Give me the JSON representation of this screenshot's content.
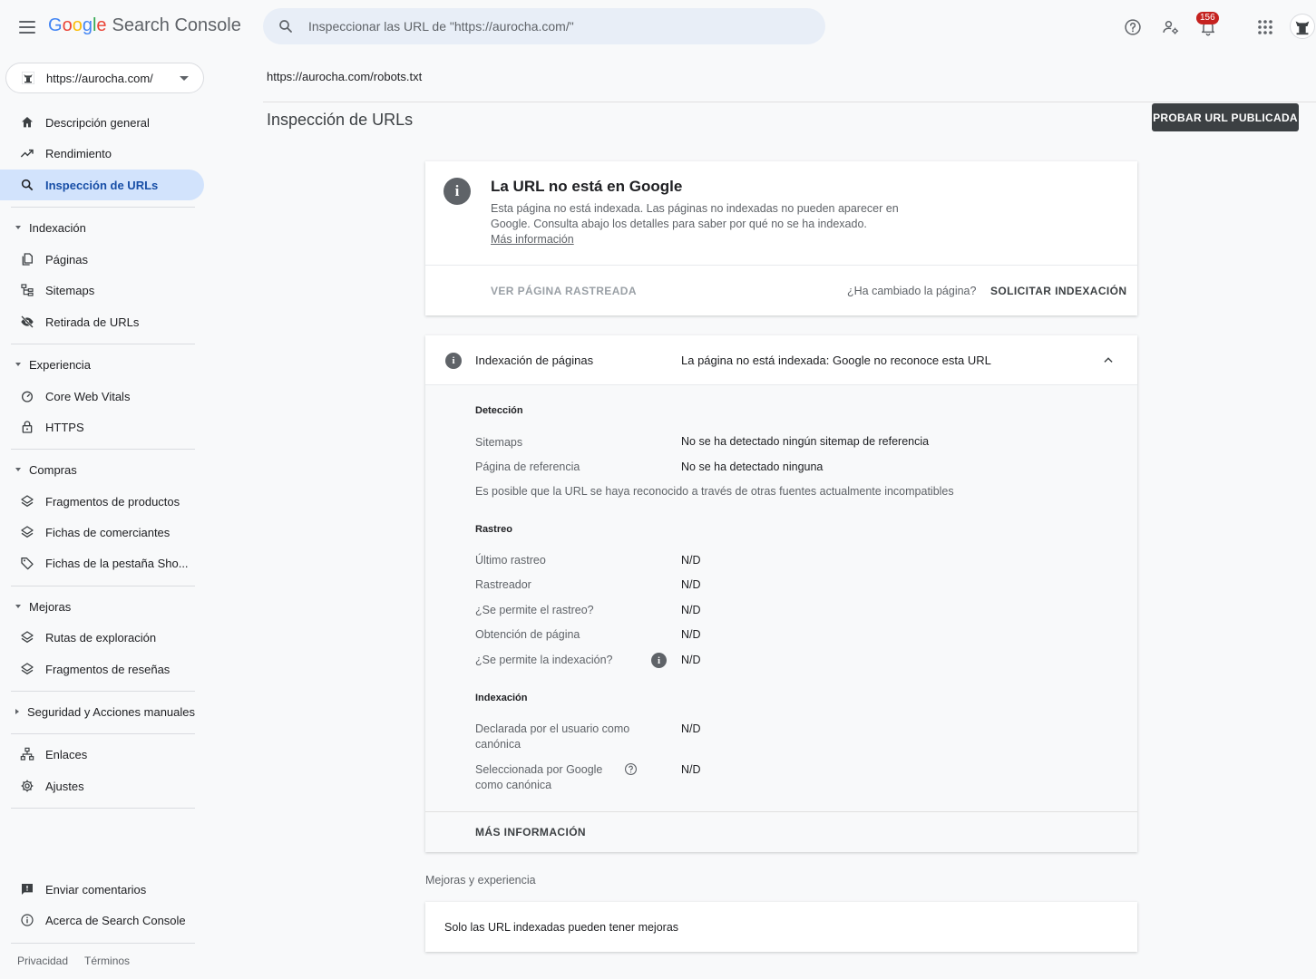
{
  "header": {
    "logo_letters": [
      "G",
      "o",
      "o",
      "g",
      "l",
      "e"
    ],
    "product_name": "Search Console",
    "search_placeholder": "Inspeccionar las URL de \"https://aurocha.com/\"",
    "notification_count": "156"
  },
  "sidebar": {
    "property": "https://aurocha.com/",
    "items_top": [
      {
        "label": "Descripción general",
        "icon": "home-icon"
      },
      {
        "label": "Rendimiento",
        "icon": "trending-up-icon"
      },
      {
        "label": "Inspección de URLs",
        "icon": "search-icon",
        "active": true
      }
    ],
    "indexacion": {
      "title": "Indexación",
      "items": [
        {
          "label": "Páginas",
          "icon": "pages-icon"
        },
        {
          "label": "Sitemaps",
          "icon": "sitemap-icon"
        },
        {
          "label": "Retirada de URLs",
          "icon": "eye-off-icon"
        }
      ]
    },
    "experiencia": {
      "title": "Experiencia",
      "items": [
        {
          "label": "Core Web Vitals",
          "icon": "speed-gauge-icon"
        },
        {
          "label": "HTTPS",
          "icon": "lock-icon"
        }
      ]
    },
    "compras": {
      "title": "Compras",
      "items": [
        {
          "label": "Fragmentos de productos",
          "icon": "layers-icon"
        },
        {
          "label": "Fichas de comerciantes",
          "icon": "layers-icon"
        },
        {
          "label": "Fichas de la pestaña Sho...",
          "icon": "tag-icon"
        }
      ]
    },
    "mejoras": {
      "title": "Mejoras",
      "items": [
        {
          "label": "Rutas de exploración",
          "icon": "layers-icon"
        },
        {
          "label": "Fragmentos de reseñas",
          "icon": "layers-icon"
        }
      ]
    },
    "seguridad": {
      "title": "Seguridad y Acciones manuales"
    },
    "items_bottom": [
      {
        "label": "Enlaces",
        "icon": "links-icon"
      },
      {
        "label": "Ajustes",
        "icon": "gear-icon"
      }
    ],
    "footer_items": [
      {
        "label": "Enviar comentarios",
        "icon": "feedback-icon"
      },
      {
        "label": "Acerca de Search Console",
        "icon": "info-icon"
      }
    ],
    "legal": {
      "privacy": "Privacidad",
      "terms": "Términos"
    }
  },
  "main": {
    "inspected_url": "https://aurocha.com/robots.txt",
    "page_title": "Inspección de URLs",
    "test_live_button": "PROBAR URL PUBLICADA",
    "status_card": {
      "title": "La URL no está en Google",
      "description": "Esta página no está indexada. Las páginas no indexadas no pueden aparecer en Google. Consulta abajo los detalles para saber por qué no se ha indexado.",
      "learn_more": "Más información",
      "view_crawled": "VER PÁGINA RASTREADA",
      "changed_question": "¿Ha cambiado la página?",
      "request_indexing": "SOLICITAR INDEXACIÓN"
    },
    "indexing_card": {
      "label": "Indexación de páginas",
      "value": "La página no está indexada: Google no reconoce esta URL",
      "deteccion": {
        "title": "Detección",
        "rows": [
          {
            "label": "Sitemaps",
            "value": "No se ha detectado ningún sitemap de referencia"
          },
          {
            "label": "Página de referencia",
            "value": "No se ha detectado ninguna"
          }
        ],
        "note": "Es posible que la URL se haya reconocido a través de otras fuentes actualmente incompatibles"
      },
      "rastreo": {
        "title": "Rastreo",
        "rows": [
          {
            "label": "Último rastreo",
            "value": "N/D"
          },
          {
            "label": "Rastreador",
            "value": "N/D"
          },
          {
            "label": "¿Se permite el rastreo?",
            "value": "N/D"
          },
          {
            "label": "Obtención de página",
            "value": "N/D"
          },
          {
            "label": "¿Se permite la indexación?",
            "value": "N/D"
          }
        ]
      },
      "indexacion": {
        "title": "Indexación",
        "rows": [
          {
            "label": "Declarada por el usuario como canónica",
            "value": "N/D"
          },
          {
            "label": "Seleccionada por Google como canónica",
            "value": "N/D"
          }
        ]
      },
      "more_info": "MÁS INFORMACIÓN"
    },
    "enhancements": {
      "title": "Mejoras y experiencia",
      "message": "Solo las URL indexadas pueden tener mejoras"
    }
  }
}
